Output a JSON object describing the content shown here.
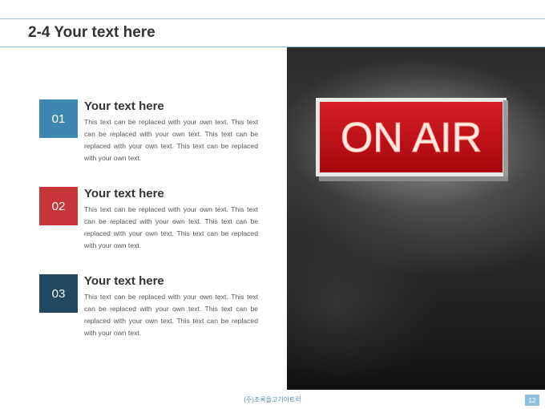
{
  "slide": {
    "title": "2-4 Your text here"
  },
  "items": [
    {
      "number": "01",
      "color": "#3d87b0",
      "title": "Your text here",
      "body": "This text can be replaced with your own text. This text can be replaced with your own text. This text can be replaced with your own text. This text can be replaced with your own text."
    },
    {
      "number": "02",
      "color": "#c8363a",
      "title": "Your text here",
      "body": "This text can be replaced with your own text. This text can be replaced with your own text. This text can be replaced with your own text. This text can be replaced with your own text."
    },
    {
      "number": "03",
      "color": "#234862",
      "title": "Your text here",
      "body": "This text can be replaced with your own text. This text can be replaced with your own text. This text can be replaced with your own text. This text can be replaced with your own text."
    }
  ],
  "photo": {
    "sign_text": "ON AIR",
    "sign_color": "#c3161c"
  },
  "footer": {
    "company": "(주)조록올고기아트럭",
    "page_number": "12"
  }
}
